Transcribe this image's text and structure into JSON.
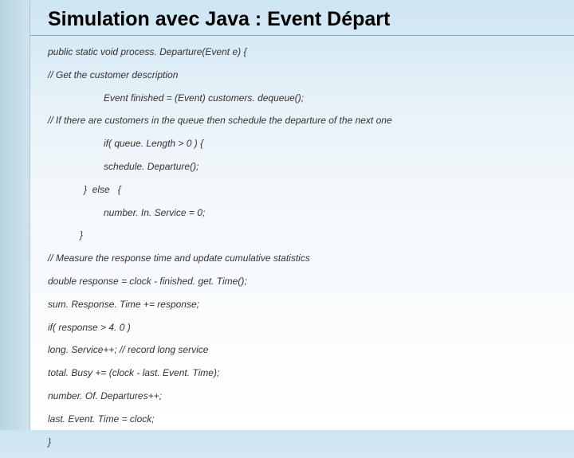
{
  "title": "Simulation avec Java : Event Départ",
  "code": {
    "l0": "public static void process. Departure(Event e) {",
    "l1": "// Get the customer description",
    "l2": "Event finished = (Event) customers. dequeue();",
    "l3": "// If there are customers in the queue then schedule the departure of the next one",
    "l4": "if( queue. Length > 0 ) {",
    "l5": "schedule. Departure();",
    "l6": "}  else   {",
    "l7": "number. In. Service = 0;",
    "l8": "}",
    "l9": "// Measure the response time and update cumulative statistics",
    "l10": "double response = clock - finished. get. Time();",
    "l11": "sum. Response. Time += response;",
    "l12": "if( response > 4. 0 )",
    "l13": "long. Service++; // record long service",
    "l14": "total. Busy += (clock - last. Event. Time);",
    "l15": "number. Of. Departures++;",
    "l16": "last. Event. Time = clock;",
    "l17": "}"
  }
}
